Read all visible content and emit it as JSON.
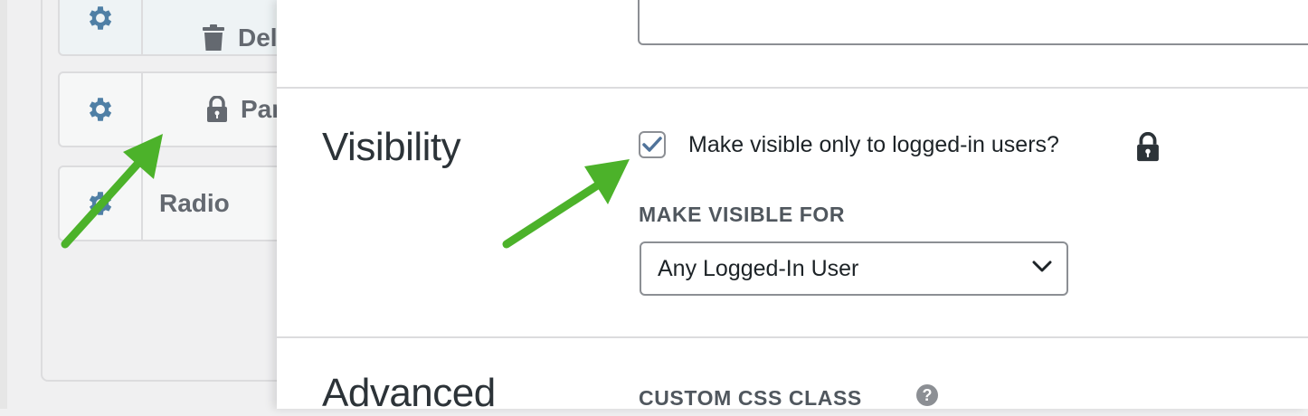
{
  "colors": {
    "arrow": "#4cb22a",
    "gear": "#4f7fa5",
    "checkbox_check": "#50739a",
    "icon_gray": "#646970"
  },
  "field_list": {
    "items": [
      {
        "label": "Delete",
        "icon": "trash-icon"
      },
      {
        "label": "Parag",
        "icon": "lock-icon"
      },
      {
        "label": "Radio",
        "icon": ""
      }
    ]
  },
  "visibility": {
    "title": "Visibility",
    "checkbox_checked": true,
    "checkbox_label": "Make visible only to logged-in users?",
    "make_visible_for_label": "MAKE VISIBLE FOR",
    "select_value": "Any Logged-In User"
  },
  "advanced": {
    "title": "Advanced",
    "custom_css_label": "CUSTOM CSS CLASS",
    "help_glyph": "?"
  }
}
